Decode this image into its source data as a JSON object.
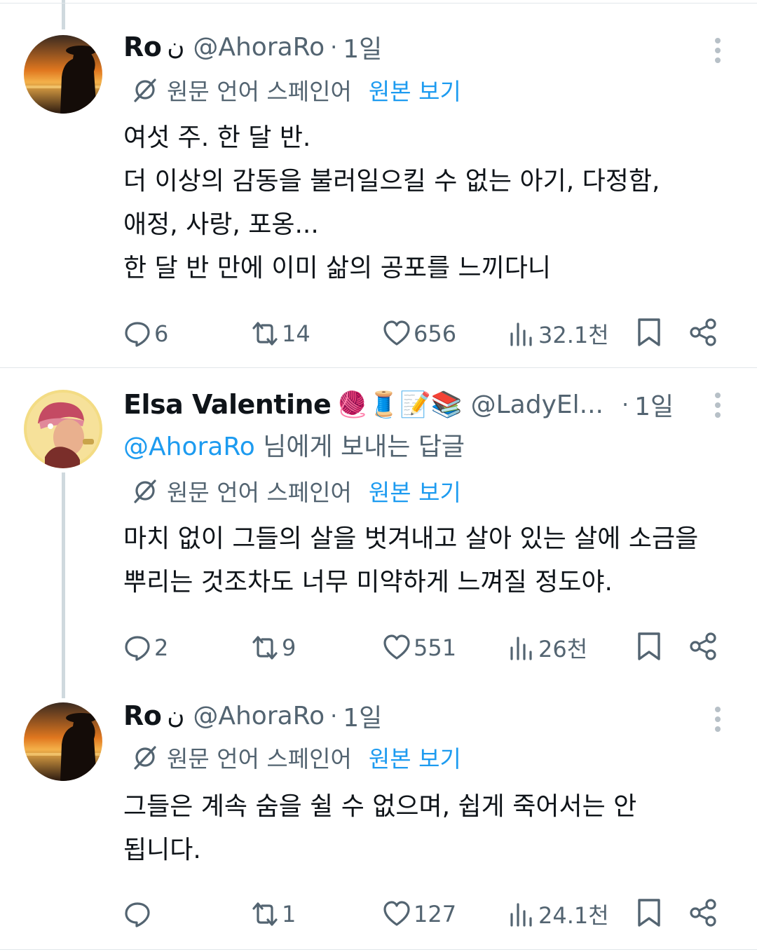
{
  "translate": {
    "language_label": "원문 언어 스페인어",
    "show_original": "원본 보기"
  },
  "tweets": [
    {
      "name": "Ro",
      "name_glyph": "ن",
      "handle": "@AhoraRo",
      "time": "1일",
      "lines": [
        "여섯 주. 한 달 반.",
        "더 이상의 감동을 불러일으킬 수 없는 아기, 다정함,",
        "애정, 사랑, 포옹...",
        "한 달 반 만에 이미 삶의 공포를 느끼다니"
      ],
      "replies": "6",
      "reposts": "14",
      "likes": "656",
      "views": "32.1천"
    },
    {
      "name": "Elsa Valentine",
      "name_emoji": "🧶🧵📝📚",
      "handle": "@LadyEl...",
      "time": "1일",
      "reply_mention": "@AhoraRo",
      "reply_suffix": " 님에게 보내는 답글",
      "lines": [
        "마치 없이 그들의 살을 벗겨내고 살아 있는 살에 소금을",
        "뿌리는 것조차도 너무 미약하게 느껴질 정도야."
      ],
      "replies": "2",
      "reposts": "9",
      "likes": "551",
      "views": "26천"
    },
    {
      "name": "Ro",
      "name_glyph": "ن",
      "handle": "@AhoraRo",
      "time": "1일",
      "lines": [
        "그들은 계속 숨을 쉴 수 없으며, 쉽게 죽어서는 안",
        "됩니다."
      ],
      "replies": "",
      "reposts": "1",
      "likes": "127",
      "views": "24.1천"
    }
  ],
  "sep": "·",
  "colors": {
    "accent": "#1d9bf0",
    "muted": "#536471",
    "text": "#0f1419",
    "thread": "#cfd9de"
  },
  "icons": [
    "more-icon",
    "translate-icon",
    "reply-icon",
    "repost-icon",
    "like-icon",
    "views-icon",
    "bookmark-icon",
    "share-icon"
  ]
}
